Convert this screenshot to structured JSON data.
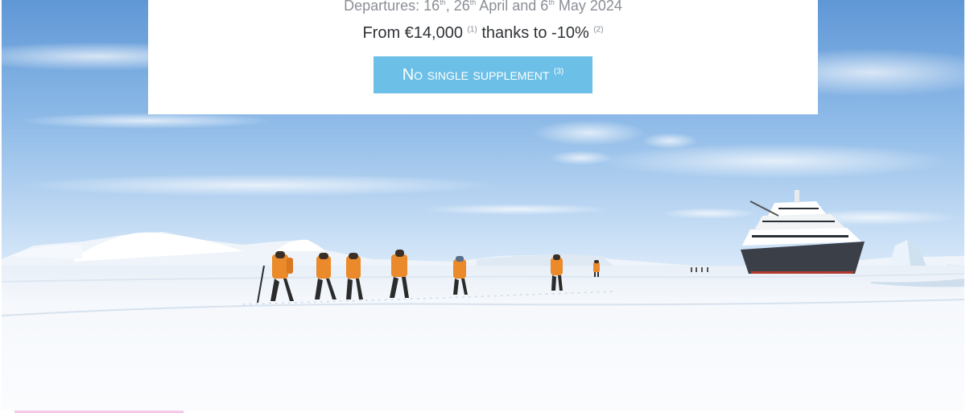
{
  "hero": {
    "scene": {
      "sky_top": "#5f97d6",
      "sky_mid": "#a9cdf0",
      "sky_horizon": "#dcebfa",
      "ice": "#f4f8fc",
      "ice_shadow": "#dbe6f2",
      "jacket": "#ea8a2a",
      "hull": "#3b4048"
    }
  },
  "card": {
    "departures": {
      "prefix": "Departures: 16",
      "sup1": "th",
      "mid1": ", 26",
      "sup2": "th",
      "mid2": " April and 6",
      "sup3": "th",
      "suffix": " May 2024"
    },
    "price": {
      "prefix": "From €14,000",
      "note1": "(1)",
      "middle": "thanks to -10%",
      "note2": "(2)"
    },
    "cta": {
      "label": "No single supplement",
      "note": "(3)",
      "color": "#6cbfe6"
    }
  }
}
